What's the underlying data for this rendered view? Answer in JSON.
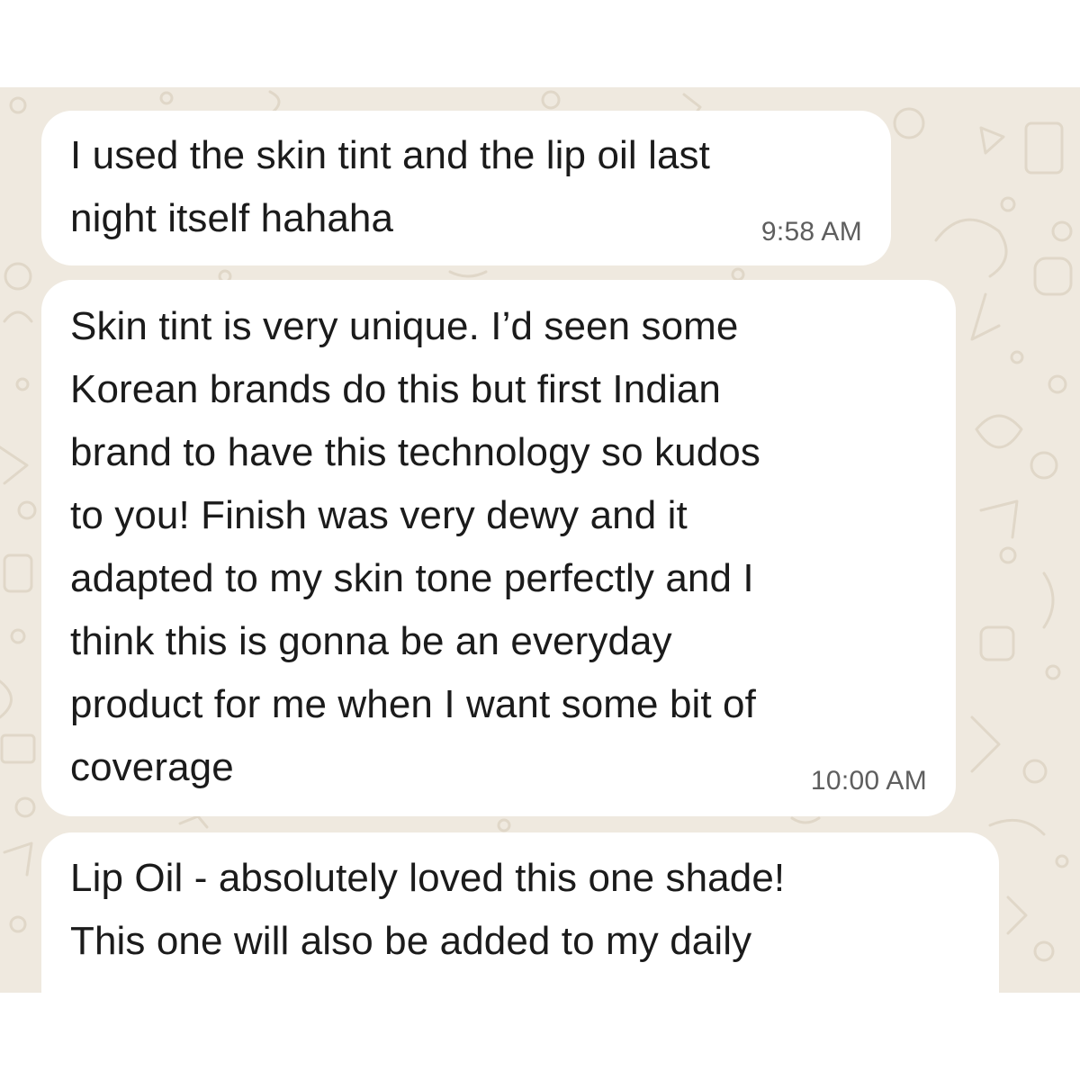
{
  "messages": [
    {
      "lines": [
        "I used the skin tint and the lip oil last",
        "night itself hahaha"
      ],
      "time": "9:58 AM"
    },
    {
      "lines": [
        "Skin tint is very unique. I’d seen some",
        "Korean brands do this but first Indian",
        "brand to have this technology so kudos",
        "to you! Finish was very dewy and it",
        "adapted to my skin tone perfectly and I",
        "think this is gonna be an everyday",
        "product for me when I want some bit of",
        "coverage"
      ],
      "time": "10:00 AM"
    },
    {
      "lines": [
        "Lip Oil - absolutely loved this one shade!",
        "This one will also be added to my daily"
      ],
      "time": ""
    }
  ],
  "colors": {
    "wallpaper": "#efe9df",
    "wallpaper_doodle": "#e0d7c8",
    "bubble": "#ffffff",
    "text": "#1b1b1b",
    "timestamp": "#5e5e5e"
  }
}
